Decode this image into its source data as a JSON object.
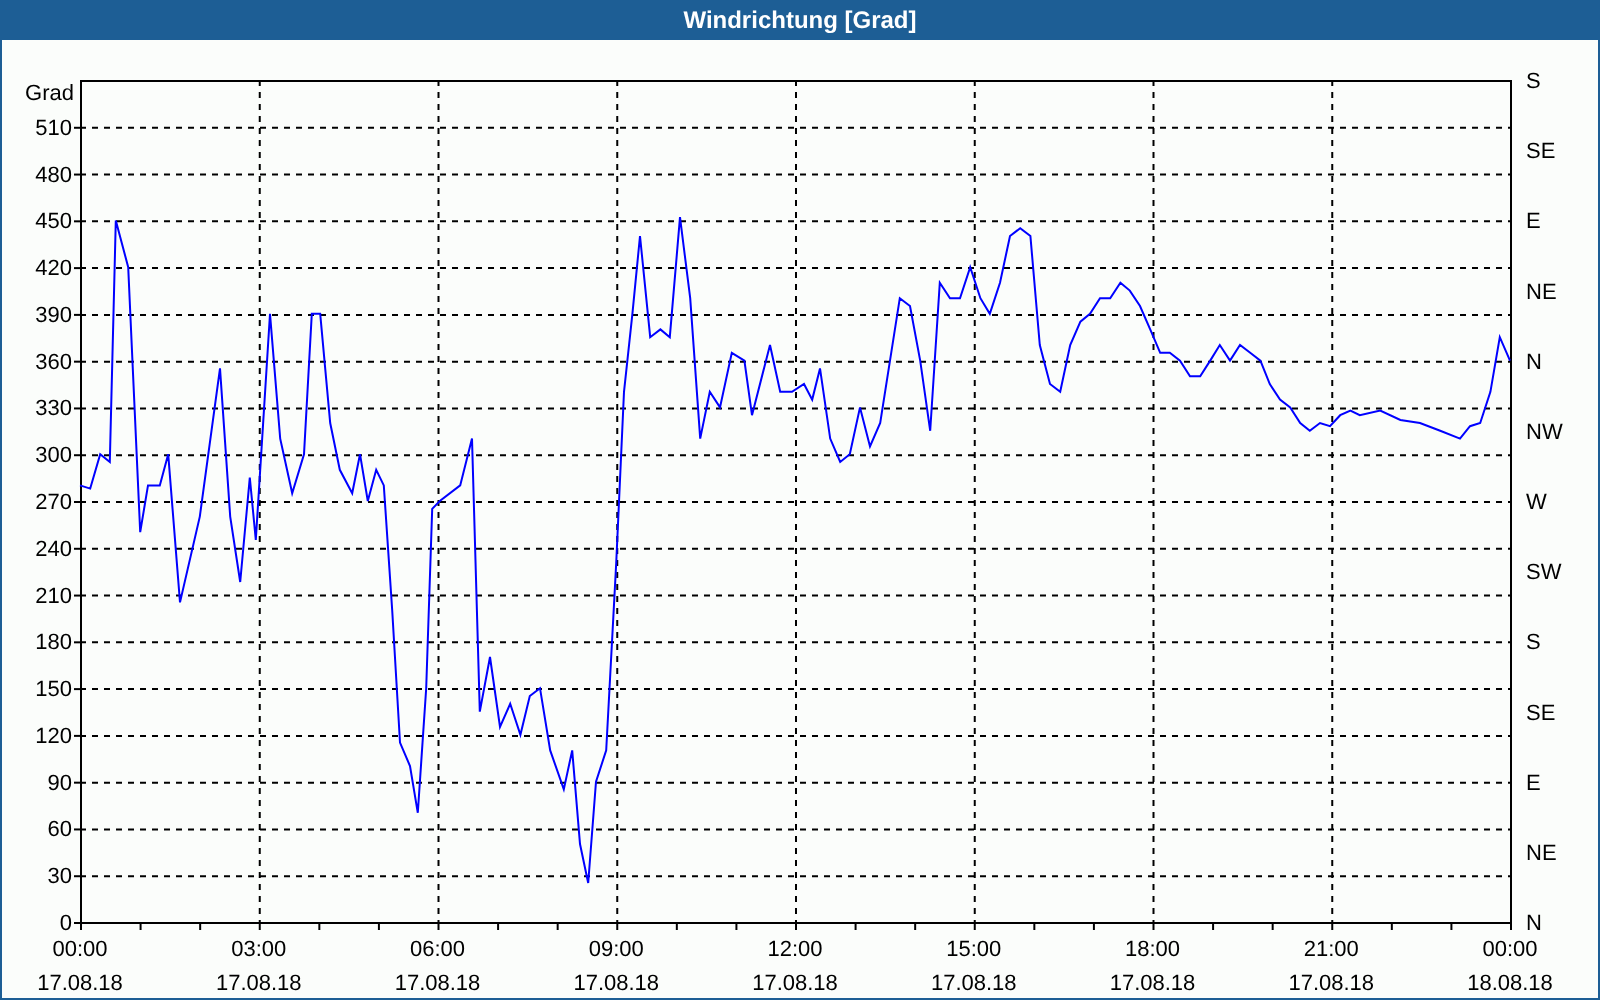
{
  "window": {
    "title": "Windrichtung [Grad]"
  },
  "chart": {
    "date_labels": [
      "17.08.18",
      "17.08.18",
      "17.08.18",
      "17.08.18",
      "17.08.18",
      "17.08.18",
      "17.08.18",
      "17.08.18",
      "18.08.18"
    ],
    "direction_labels": [
      "S",
      "SE",
      "E",
      "NE",
      "N",
      "NW",
      "W",
      "SW",
      "S",
      "SE",
      "E",
      "NE",
      "N"
    ],
    "chart_data": {
      "type": "line",
      "grid": true,
      "ylabel": "Grad",
      "xlim": [
        0,
        24
      ],
      "ylim": [
        0,
        540
      ],
      "yticks": [
        0,
        30,
        60,
        90,
        120,
        150,
        180,
        210,
        240,
        270,
        300,
        330,
        360,
        390,
        420,
        450,
        480,
        510
      ],
      "xticks": [
        {
          "value": 0,
          "label": "00:00"
        },
        {
          "value": 3,
          "label": "03:00"
        },
        {
          "value": 6,
          "label": "06:00"
        },
        {
          "value": 9,
          "label": "09:00"
        },
        {
          "value": 12,
          "label": "12:00"
        },
        {
          "value": 15,
          "label": "15:00"
        },
        {
          "value": 18,
          "label": "18:00"
        },
        {
          "value": 21,
          "label": "21:00"
        },
        {
          "value": 24,
          "label": "00:00"
        }
      ],
      "x": [
        0,
        0.17,
        0.34,
        0.5,
        0.6,
        0.81,
        1.01,
        1.14,
        1.34,
        1.48,
        1.68,
        2.01,
        2.35,
        2.52,
        2.69,
        2.85,
        2.95,
        3.19,
        3.36,
        3.56,
        3.76,
        3.89,
        4.03,
        4.2,
        4.36,
        4.57,
        4.7,
        4.83,
        4.97,
        5.1,
        5.24,
        5.37,
        5.54,
        5.67,
        5.81,
        5.91,
        6.04,
        6.38,
        6.58,
        6.71,
        6.88,
        7.05,
        7.22,
        7.39,
        7.55,
        7.72,
        7.89,
        8.12,
        8.26,
        8.39,
        8.53,
        8.66,
        8.83,
        9.0,
        9.13,
        9.27,
        9.4,
        9.57,
        9.74,
        9.9,
        10.07,
        10.24,
        10.41,
        10.57,
        10.74,
        10.94,
        11.15,
        11.28,
        11.58,
        11.75,
        11.95,
        12.15,
        12.29,
        12.42,
        12.59,
        12.76,
        12.92,
        13.09,
        13.26,
        13.43,
        13.76,
        13.93,
        14.1,
        14.27,
        14.43,
        14.6,
        14.77,
        14.94,
        15.11,
        15.27,
        15.44,
        15.61,
        15.78,
        15.95,
        16.11,
        16.28,
        16.45,
        16.62,
        16.79,
        16.95,
        17.12,
        17.29,
        17.46,
        17.62,
        17.79,
        17.96,
        18.13,
        18.29,
        18.46,
        18.63,
        18.8,
        18.97,
        19.13,
        19.3,
        19.47,
        19.64,
        19.81,
        19.97,
        20.14,
        20.31,
        20.48,
        20.64,
        20.81,
        20.98,
        21.15,
        21.32,
        21.48,
        21.82,
        22.16,
        22.49,
        22.83,
        23.16,
        23.33,
        23.5,
        23.67,
        23.83,
        24
      ],
      "series": [
        {
          "color": "#0000ff",
          "values": [
            280,
            278,
            300,
            295,
            450,
            420,
            250,
            280,
            280,
            300,
            205,
            260,
            355,
            260,
            218,
            285,
            245,
            390,
            310,
            275,
            300,
            390,
            390,
            320,
            290,
            275,
            300,
            270,
            290,
            280,
            200,
            115,
            100,
            70,
            150,
            265,
            270,
            280,
            310,
            135,
            170,
            125,
            140,
            120,
            145,
            150,
            110,
            85,
            110,
            50,
            25,
            90,
            110,
            230,
            340,
            390,
            440,
            375,
            380,
            375,
            452,
            400,
            310,
            340,
            330,
            365,
            360,
            325,
            370,
            340,
            340,
            345,
            335,
            355,
            310,
            295,
            300,
            330,
            305,
            320,
            400,
            395,
            360,
            315,
            410,
            400,
            400,
            420,
            400,
            390,
            410,
            440,
            445,
            440,
            370,
            345,
            340,
            370,
            385,
            390,
            400,
            400,
            410,
            405,
            395,
            380,
            365,
            365,
            360,
            350,
            350,
            360,
            370,
            360,
            370,
            365,
            360,
            345,
            335,
            330,
            320,
            315,
            320,
            318,
            325,
            328,
            325,
            328,
            322,
            320,
            315,
            310,
            318,
            320,
            340,
            375,
            360
          ]
        }
      ]
    }
  }
}
